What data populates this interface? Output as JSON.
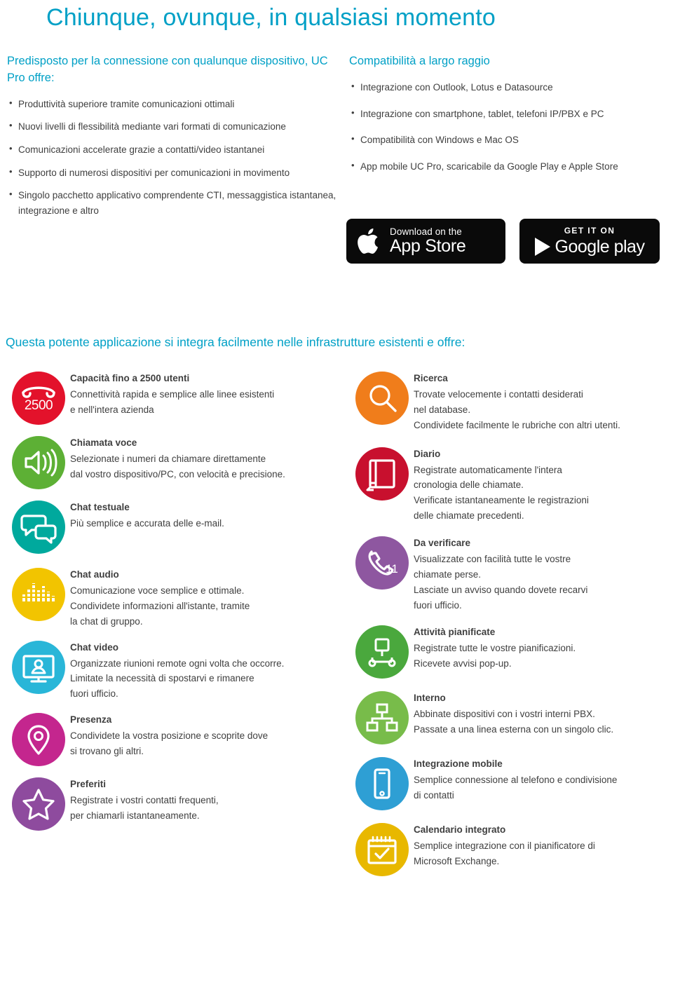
{
  "title": "Chiunque, ovunque, in qualsiasi momento",
  "intro": {
    "left": {
      "heading": "Predisposto per la connessione con qualunque dispositivo, UC Pro offre:",
      "bullets": [
        "Produttività superiore tramite comunicazioni ottimali",
        "Nuovi livelli di flessibilità mediante vari formati di comunicazione",
        "Comunicazioni accelerate grazie a contatti/video istantanei",
        "Supporto di numerosi dispositivi per comunicazioni in movimento",
        "Singolo pacchetto applicativo comprendente CTI, messaggistica istantanea, integrazione e altro"
      ]
    },
    "right": {
      "heading": "Compatibilità a largo raggio",
      "bullets": [
        "Integrazione con Outlook, Lotus e Datasource",
        "Integrazione con smartphone, tablet, telefoni IP/PBX e PC",
        "Compatibilità con Windows e Mac OS",
        "App mobile UC Pro, scaricabile da Google Play e Apple Store"
      ]
    }
  },
  "badges": {
    "apple": {
      "small": "Download on the",
      "big": "App Store",
      "icon": "apple-logo-icon"
    },
    "google": {
      "small": "GET IT ON",
      "big": "Google play",
      "icon": "google-play-triangle-icon"
    }
  },
  "section_heading": "Questa potente applicazione si integra facilmente nelle infrastrutture esistenti e offre:",
  "colors": {
    "accent": "#00a0c6",
    "text": "#3f3f3f",
    "red": "#e3122b",
    "green": "#5db035",
    "teal": "#00a99d",
    "yellow": "#f2c400",
    "cyan": "#29b6d8",
    "magenta": "#c4268e",
    "purple": "#8e4b9e",
    "orange": "#f07d1b",
    "darkred": "#c8102e",
    "violet": "#8e57a0",
    "green2": "#4aa83d",
    "lightgreen": "#78bc4a",
    "blue": "#2e9fd4",
    "gold": "#e8b800"
  },
  "features_left": [
    {
      "icon": "phone-2500-icon",
      "color": "#e3122b",
      "title": "Capacità fino a 2500 utenti",
      "lines": [
        "Connettività rapida e semplice alle linee esistenti",
        "e nell'intera azienda"
      ]
    },
    {
      "icon": "speaker-voice-icon",
      "color": "#5db035",
      "title": "Chiamata voce",
      "lines": [
        "Selezionate i numeri da chiamare direttamente",
        "dal vostro dispositivo/PC, con velocità e precisione."
      ]
    },
    {
      "icon": "chat-bubbles-icon",
      "color": "#00a99d",
      "title": "Chat testuale",
      "lines": [
        "Più semplice e accurata delle e-mail."
      ]
    },
    {
      "icon": "audio-equalizer-icon",
      "color": "#f2c400",
      "title": "Chat audio",
      "lines": [
        "Comunicazione voce semplice e ottimale.",
        "Condividete informazioni all'istante, tramite",
        "la chat di gruppo."
      ]
    },
    {
      "icon": "video-monitor-icon",
      "color": "#29b6d8",
      "title": "Chat video",
      "lines": [
        "Organizzate riunioni remote ogni volta che occorre.",
        "Limitate la necessità di spostarvi e rimanere",
        "fuori ufficio."
      ]
    },
    {
      "icon": "location-pin-icon",
      "color": "#c4268e",
      "title": "Presenza",
      "lines": [
        "Condividete la vostra posizione e scoprite dove",
        "si trovano gli altri."
      ]
    },
    {
      "icon": "star-favorites-icon",
      "color": "#8e4b9e",
      "title": "Preferiti",
      "lines": [
        "Registrate i vostri contatti frequenti,",
        "per chiamarli istantaneamente."
      ]
    }
  ],
  "features_right": [
    {
      "icon": "search-magnifier-icon",
      "color": "#f07d1b",
      "title": "Ricerca",
      "lines": [
        "Trovate velocemente i contatti desiderati",
        "nel database.",
        "Condividete facilmente le rubriche con altri utenti."
      ]
    },
    {
      "icon": "journal-book-icon",
      "color": "#c8102e",
      "title": "Diario",
      "lines": [
        "Registrate automaticamente l'intera",
        "cronologia delle chiamate.",
        "Verificate istantaneamente le registrazioni",
        "delle chiamate precedenti."
      ]
    },
    {
      "icon": "missed-calls-icon",
      "color": "#8e57a0",
      "title": "Da verificare",
      "lines": [
        "Visualizzate con facilità tutte le vostre",
        "chiamate perse.",
        "Lasciate un avviso quando dovete recarvi",
        "fuori ufficio."
      ]
    },
    {
      "icon": "scheduled-activity-icon",
      "color": "#4aa83d",
      "title": "Attività pianificate",
      "lines": [
        "Registrate tutte le vostre pianificazioni.",
        "Ricevete avvisi pop-up."
      ]
    },
    {
      "icon": "internal-network-icon",
      "color": "#78bc4a",
      "title": "Interno",
      "lines": [
        "Abbinate dispositivi con i vostri interni PBX.",
        "Passate a una linea esterna con un singolo clic."
      ]
    },
    {
      "icon": "mobile-phone-icon",
      "color": "#2e9fd4",
      "title": "Integrazione mobile",
      "lines": [
        "Semplice connessione al telefono e condivisione",
        "di contatti"
      ]
    },
    {
      "icon": "calendar-check-icon",
      "color": "#e8b800",
      "title": "Calendario integrato",
      "lines": [
        "Semplice integrazione con il pianificatore di",
        "Microsoft Exchange."
      ]
    }
  ]
}
